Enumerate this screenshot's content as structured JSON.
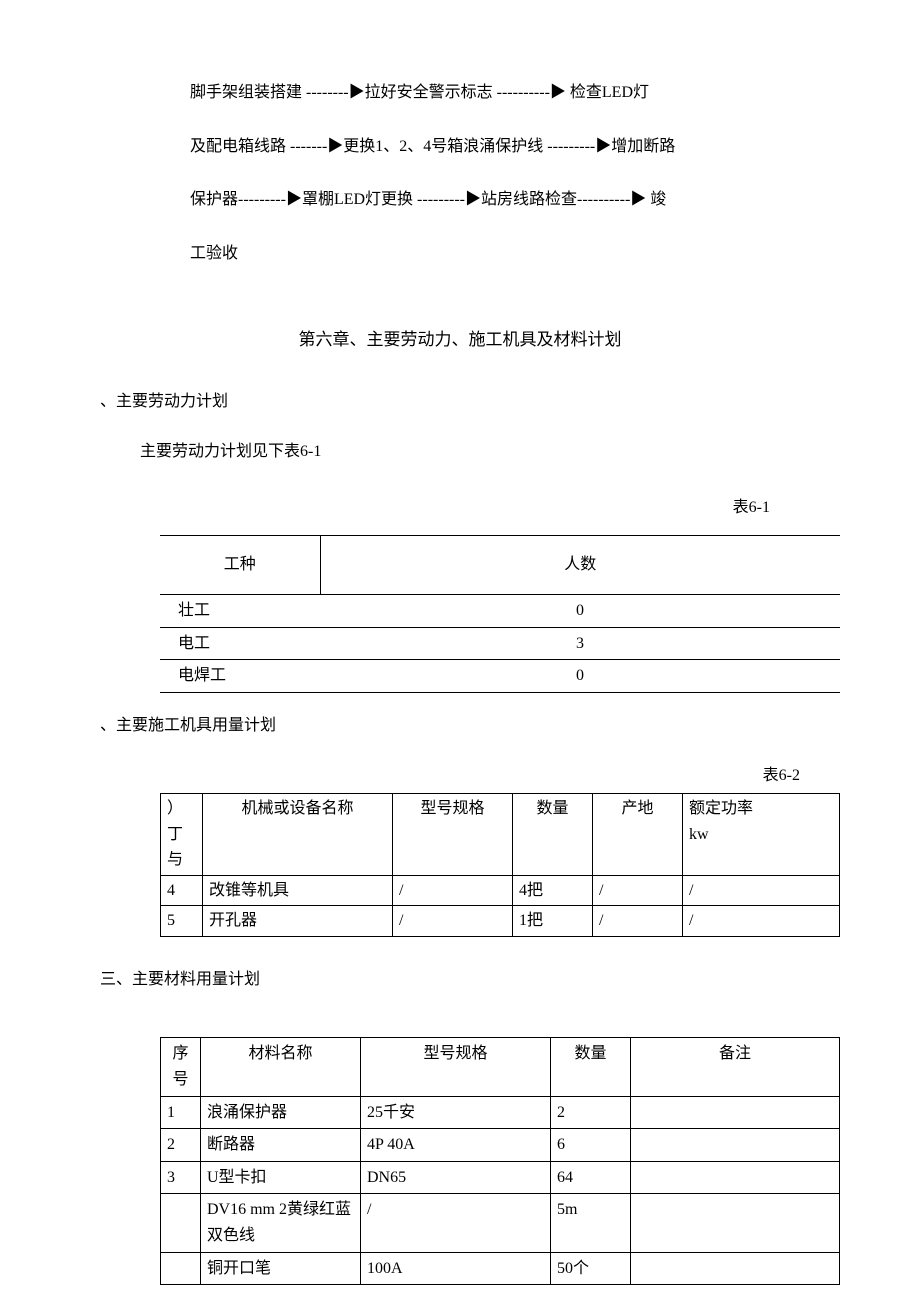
{
  "flow": {
    "line1": "脚手架组装搭建  --------▶拉好安全警示标志  ----------▶  检查LED灯",
    "line2": "及配电箱线路  -------▶更换1、2、4号箱浪涌保护线  ---------▶增加断路",
    "line3": "保护器---------▶罩棚LED灯更换  ---------▶站房线路检查----------▶  竣",
    "line4": "工验收"
  },
  "chapter_title": "第六章、主要劳动力、施工机具及材料计划",
  "sections": {
    "s1_title": "、主要劳动力计划",
    "s1_sub": "主要劳动力计划见下表6-1",
    "s1_caption": "表6-1",
    "s2_title": "、主要施工机具用量计划",
    "s2_caption": "表6-2",
    "s3_title": "三、主要材料用量计划"
  },
  "table61": {
    "headers": [
      "工种",
      "人数"
    ],
    "rows": [
      [
        "壮工",
        "0"
      ],
      [
        "电工",
        "3"
      ],
      [
        "电焊工",
        "0"
      ]
    ]
  },
  "table62": {
    "headers": {
      "num": "）丁\n与",
      "name": "机械或设备名称",
      "spec": "型号规格",
      "qty": "数量",
      "origin": "产地",
      "power": "额定功率\nkw"
    },
    "rows": [
      [
        "4",
        "改锥等机具",
        "/",
        "4把",
        "/",
        "/"
      ],
      [
        "5",
        "开孔器",
        "/",
        "1把",
        "/",
        "/"
      ]
    ]
  },
  "tableMat": {
    "headers": {
      "num": "序\n号",
      "name": "材料名称",
      "spec": "型号规格",
      "qty": "数量",
      "note": "备注"
    },
    "rows": [
      [
        "1",
        "浪涌保护器",
        "25千安",
        "2",
        ""
      ],
      [
        "2",
        "断路器",
        "4P 40A",
        "6",
        ""
      ],
      [
        "3",
        "U型卡扣",
        "DN65",
        "64",
        ""
      ],
      [
        "",
        "DV16 mm 2黄绿红蓝双色线",
        "/",
        "5m",
        ""
      ],
      [
        "",
        "铜开口笔",
        "100A",
        "50个",
        ""
      ]
    ]
  }
}
